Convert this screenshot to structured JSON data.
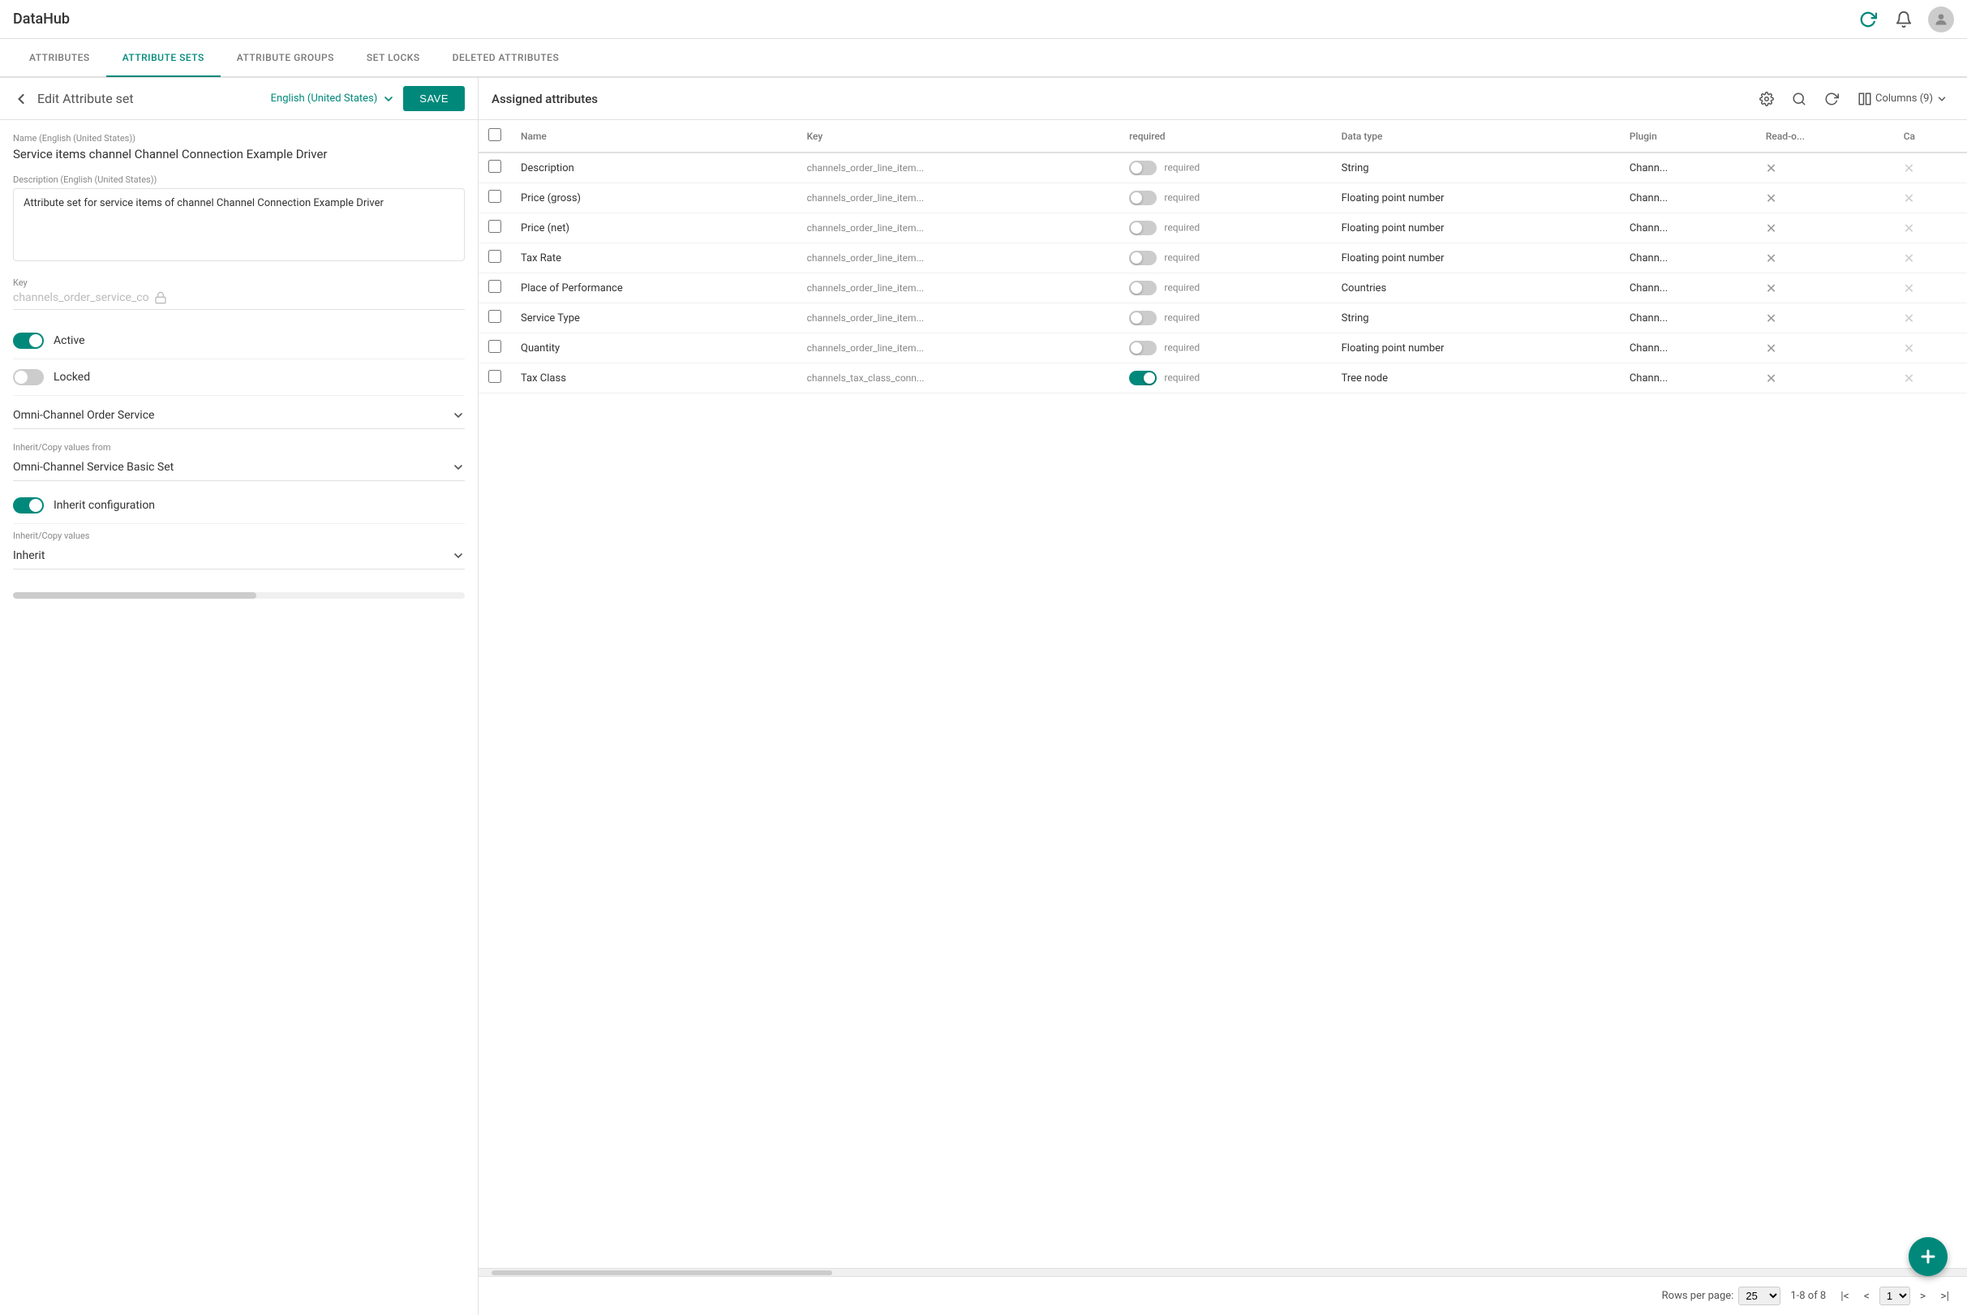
{
  "app": {
    "title": "DataHub"
  },
  "tabs": [
    {
      "id": "attributes",
      "label": "ATTRIBUTES",
      "active": false
    },
    {
      "id": "attribute-sets",
      "label": "ATTRIBUTE SETS",
      "active": true
    },
    {
      "id": "attribute-groups",
      "label": "ATTRIBUTE GROUPS",
      "active": false
    },
    {
      "id": "set-locks",
      "label": "SET LOCKS",
      "active": false
    },
    {
      "id": "deleted-attributes",
      "label": "DELETED ATTRIBUTES",
      "active": false
    }
  ],
  "left_panel": {
    "back_label": "Edit Attribute set",
    "language": "English (United States)",
    "save_label": "SAVE",
    "name_label": "Name (English (United States))",
    "name_value": "Service items channel Channel Connection Example Driver",
    "description_label": "Description (English (United States))",
    "description_value": "Attribute set for service items of channel Channel Connection Example Driver",
    "key_label": "Key",
    "key_value": "channels_order_service_co",
    "active_label": "Active",
    "active_on": true,
    "locked_label": "Locked",
    "locked_on": false,
    "channel_label": "",
    "channel_value": "Omni-Channel Order Service",
    "inherit_copy_label": "Inherit/Copy values from",
    "inherit_copy_value": "Omni-Channel Service Basic Set",
    "inherit_config_label": "Inherit configuration",
    "inherit_config_on": true,
    "inherit_values_label": "Inherit/Copy values",
    "inherit_values_value": "Inherit"
  },
  "right_panel": {
    "title": "Assigned attributes",
    "columns_label": "Columns (9)",
    "table": {
      "columns": [
        "Name",
        "Key",
        "required",
        "Data type",
        "Plugin",
        "Read-o...",
        "Ca"
      ],
      "rows": [
        {
          "name": "Description",
          "key": "channels_order_line_item...",
          "required_toggle": false,
          "required_label": "required",
          "data_type": "String",
          "plugin": "Chann...",
          "readonly": true,
          "ca": true
        },
        {
          "name": "Price (gross)",
          "key": "channels_order_line_item...",
          "required_toggle": false,
          "required_label": "required",
          "data_type": "Floating point number",
          "plugin": "Chann...",
          "readonly": true,
          "ca": true
        },
        {
          "name": "Price (net)",
          "key": "channels_order_line_item...",
          "required_toggle": false,
          "required_label": "required",
          "data_type": "Floating point number",
          "plugin": "Chann...",
          "readonly": true,
          "ca": true
        },
        {
          "name": "Tax Rate",
          "key": "channels_order_line_item...",
          "required_toggle": false,
          "required_label": "required",
          "data_type": "Floating point number",
          "plugin": "Chann...",
          "readonly": true,
          "ca": true
        },
        {
          "name": "Place of Performance",
          "key": "channels_order_line_item...",
          "required_toggle": false,
          "required_label": "required",
          "data_type": "Countries",
          "plugin": "Chann...",
          "readonly": true,
          "ca": true
        },
        {
          "name": "Service Type",
          "key": "channels_order_line_item...",
          "required_toggle": false,
          "required_label": "required",
          "data_type": "String",
          "plugin": "Chann...",
          "readonly": true,
          "ca": true
        },
        {
          "name": "Quantity",
          "key": "channels_order_line_item...",
          "required_toggle": false,
          "required_label": "required",
          "data_type": "Floating point number",
          "plugin": "Chann...",
          "readonly": true,
          "ca": true
        },
        {
          "name": "Tax Class",
          "key": "channels_tax_class_conn...",
          "required_toggle": true,
          "required_label": "required",
          "data_type": "Tree node",
          "plugin": "Chann...",
          "readonly": true,
          "ca": true
        }
      ]
    },
    "footer": {
      "rows_per_page_label": "Rows per page:",
      "rows_per_page_value": "25",
      "total_label": "1-8 of 8",
      "page_value": "1"
    }
  }
}
